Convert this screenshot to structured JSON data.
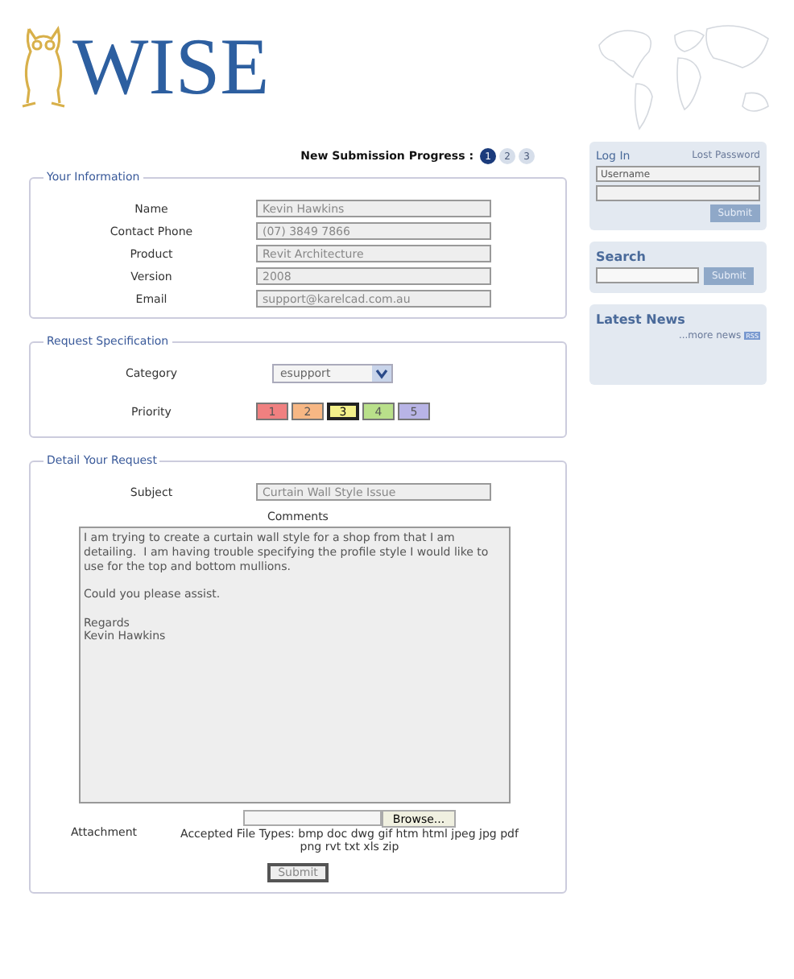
{
  "logo": {
    "text": "WISE"
  },
  "progress": {
    "label": "New Submission Progress :",
    "steps": [
      {
        "label": "1",
        "selected": true
      },
      {
        "label": "2",
        "selected": false
      },
      {
        "label": "3",
        "selected": false
      }
    ]
  },
  "your_information": {
    "legend": "Your Information",
    "fields": [
      {
        "label": "Name",
        "value": "Kevin Hawkins"
      },
      {
        "label": "Contact Phone",
        "value": "(07) 3849 7866"
      },
      {
        "label": "Product",
        "value": "Revit Architecture"
      },
      {
        "label": "Version",
        "value": "2008"
      },
      {
        "label": "Email",
        "value": "support@karelcad.com.au"
      }
    ]
  },
  "request_specification": {
    "legend": "Request Specification",
    "category_label": "Category",
    "category_value": "esupport",
    "priority_label": "Priority",
    "priorities": [
      {
        "label": "1",
        "color": "#f08080",
        "selected": false
      },
      {
        "label": "2",
        "color": "#f7b784",
        "selected": false
      },
      {
        "label": "3",
        "color": "#f3f08a",
        "selected": true
      },
      {
        "label": "4",
        "color": "#b9e08a",
        "selected": false
      },
      {
        "label": "5",
        "color": "#b8b4e6",
        "selected": false
      }
    ]
  },
  "detail": {
    "legend": "Detail Your Request",
    "subject_label": "Subject",
    "subject_value": "Curtain Wall Style Issue",
    "comments_label": "Comments",
    "comments_value": "I am trying to create a curtain wall style for a shop from that I am detailing.  I am having trouble specifying the profile style I would like to use for the top and bottom mullions.\n\nCould you please assist.\n\nRegards\nKevin Hawkins",
    "attachment_label": "Attachment",
    "browse_button": "Browse...",
    "file_types": "Accepted File Types: bmp doc dwg gif htm html jpeg jpg pdf png rvt txt xls zip",
    "submit_button": "Submit"
  },
  "sidebar": {
    "login": {
      "title": "Log In",
      "lost_password": "Lost Password",
      "username_value": "Username",
      "submit": "Submit"
    },
    "search": {
      "title": "Search",
      "submit": "Submit"
    },
    "news": {
      "title": "Latest News",
      "more": "...more news",
      "rss": "RSS"
    }
  }
}
